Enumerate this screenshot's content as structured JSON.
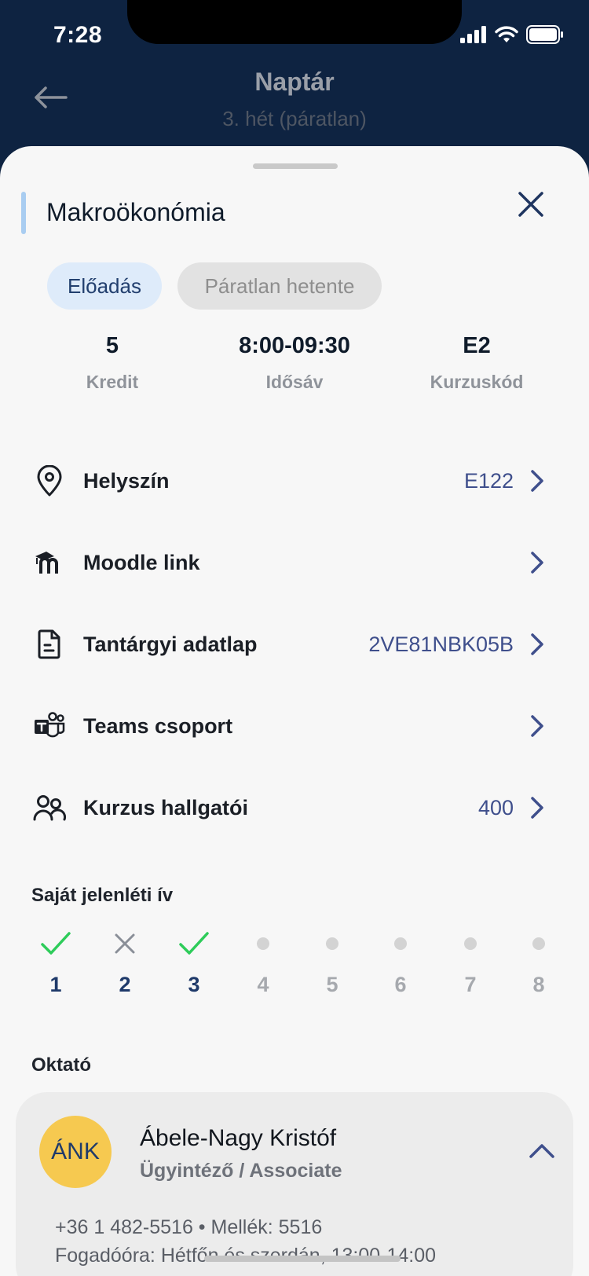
{
  "status_bar": {
    "time": "7:28"
  },
  "nav": {
    "title": "Naptár",
    "subtitle": "3. hét (páratlan)"
  },
  "course": {
    "title": "Makroökonómia",
    "chips": {
      "type": "Előadás",
      "frequency": "Páratlan hetente"
    },
    "stats": [
      {
        "value": "5",
        "label": "Kredit"
      },
      {
        "value": "8:00-09:30",
        "label": "Idősáv"
      },
      {
        "value": "E2",
        "label": "Kurzuskód"
      }
    ]
  },
  "rows": [
    {
      "icon": "location-pin-icon",
      "label": "Helyszín",
      "value": "E122"
    },
    {
      "icon": "moodle-icon",
      "label": "Moodle link",
      "value": ""
    },
    {
      "icon": "document-icon",
      "label": "Tantárgyi adatlap",
      "value": "2VE81NBK05B"
    },
    {
      "icon": "teams-icon",
      "label": "Teams csoport",
      "value": ""
    },
    {
      "icon": "users-icon",
      "label": "Kurzus hallgatói",
      "value": "400"
    }
  ],
  "attendance": {
    "title": "Saját jelenléti ív",
    "items": [
      {
        "num": "1",
        "status": "present"
      },
      {
        "num": "2",
        "status": "absent"
      },
      {
        "num": "3",
        "status": "present"
      },
      {
        "num": "4",
        "status": "upcoming"
      },
      {
        "num": "5",
        "status": "upcoming"
      },
      {
        "num": "6",
        "status": "upcoming"
      },
      {
        "num": "7",
        "status": "upcoming"
      },
      {
        "num": "8",
        "status": "upcoming"
      }
    ]
  },
  "teacher_section": {
    "title": "Oktató",
    "initials": "ÁNK",
    "name": "Ábele-Nagy Kristóf",
    "role": "Ügyintéző / Associate",
    "phone": "+36 1 482-5516 • Mellék: 5516",
    "office_hours": "Fogadóóra: Hétfőn és szerdán, 13:00-14:00"
  },
  "colors": {
    "header_bg": "#0e2341",
    "accent": "#3f4f8c",
    "present": "#2ecc5a",
    "absent": "#8a8f98",
    "avatar": "#f6c950"
  }
}
